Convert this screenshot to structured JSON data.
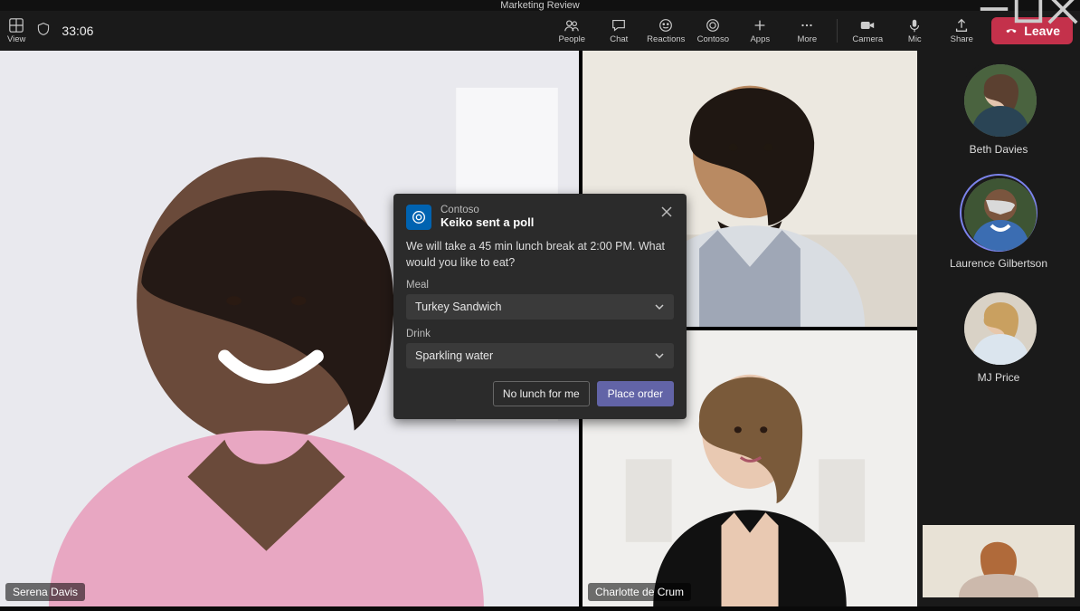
{
  "meeting_title": "Marketing Review",
  "view_label": "View",
  "timer": "33:06",
  "toolbar": {
    "people": "People",
    "chat": "Chat",
    "reactions": "Reactions",
    "app_contoso": "Contoso",
    "apps": "Apps",
    "more": "More",
    "camera": "Camera",
    "mic": "Mic",
    "share": "Share",
    "leave": "Leave"
  },
  "participants": {
    "main": "Serena Davis",
    "side_top": "",
    "side_bottom": "Charlotte de Crum"
  },
  "roster": [
    {
      "name": "Beth Davies",
      "speaking": false
    },
    {
      "name": "Laurence Gilbertson",
      "speaking": true
    },
    {
      "name": "MJ Price",
      "speaking": false
    }
  ],
  "poll": {
    "app_name": "Contoso",
    "title": "Keiko sent a poll",
    "message": "We will take a 45 min lunch break at 2:00 PM. What would you like to eat?",
    "fields": {
      "meal": {
        "label": "Meal",
        "value": "Turkey Sandwich"
      },
      "drink": {
        "label": "Drink",
        "value": "Sparkling water"
      }
    },
    "actions": {
      "secondary": "No lunch for me",
      "primary": "Place order"
    }
  }
}
